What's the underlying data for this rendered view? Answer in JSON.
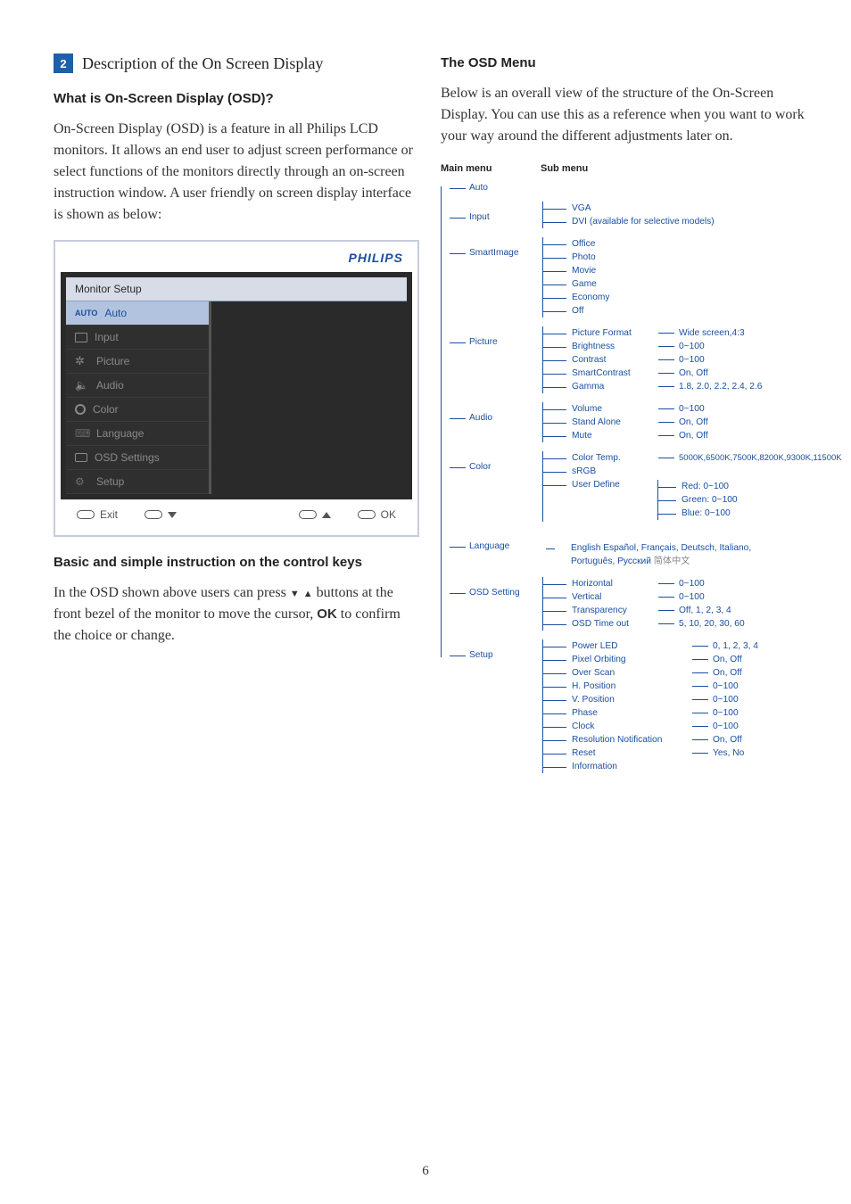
{
  "section": {
    "num": "2",
    "title": "Description of the On Screen Display"
  },
  "left": {
    "q": "What is On-Screen Display (OSD)?",
    "p1": "On-Screen Display (OSD) is a feature in all Philips LCD monitors. It allows an end user to adjust screen performance or select functions of the monitors directly through an on-screen instruction window. A user friendly on screen display interface is shown as below:",
    "basic_h": "Basic and simple instruction on the control keys",
    "p2a": "In the OSD shown above users can press ",
    "p2b": " buttons at the front bezel of the monitor to move the cursor, ",
    "p2c": " to confirm the choice or change.",
    "ok": "OK"
  },
  "osd": {
    "brand": "PHILIPS",
    "header": "Monitor Setup",
    "items": [
      {
        "badge": "AUTO",
        "label": "Auto",
        "sel": true
      },
      {
        "icon": "input-icon",
        "label": "Input"
      },
      {
        "icon": "picture-icon",
        "label": "Picture"
      },
      {
        "icon": "audio-icon",
        "label": "Audio"
      },
      {
        "icon": "color-icon",
        "label": "Color"
      },
      {
        "icon": "language-icon",
        "label": "Language"
      },
      {
        "icon": "osd-icon",
        "label": "OSD Settings"
      },
      {
        "icon": "setup-icon",
        "label": "Setup"
      }
    ],
    "footer": {
      "exit": "Exit",
      "ok": "OK"
    }
  },
  "right": {
    "h": "The OSD Menu",
    "p": "Below is an overall view of the structure of the On-Screen Display. You can use this as a reference when you want to work your way around the different adjustments later on.",
    "th_main": "Main menu",
    "th_sub": "Sub menu"
  },
  "tree": {
    "auto": "Auto",
    "input": {
      "label": "Input",
      "vga": "VGA",
      "dvi": "DVI (available for selective models)"
    },
    "smart": {
      "label": "SmartImage",
      "items": [
        "Office",
        "Photo",
        "Movie",
        "Game",
        "Economy",
        "Off"
      ]
    },
    "picture": {
      "label": "Picture",
      "rows": [
        {
          "k": "Picture Format",
          "v": "Wide screen,4:3"
        },
        {
          "k": "Brightness",
          "v": "0~100"
        },
        {
          "k": "Contrast",
          "v": "0~100"
        },
        {
          "k": "SmartContrast",
          "v": "On, Off"
        },
        {
          "k": "Gamma",
          "v": "1.8, 2.0, 2.2, 2.4, 2.6"
        }
      ]
    },
    "audio": {
      "label": "Audio",
      "rows": [
        {
          "k": "Volume",
          "v": "0~100"
        },
        {
          "k": "Stand Alone",
          "v": "On, Off"
        },
        {
          "k": "Mute",
          "v": "On, Off"
        }
      ]
    },
    "color": {
      "label": "Color",
      "temp_k": "Color Temp.",
      "temp_v": "5000K,6500K,7500K,8200K,9300K,11500K",
      "srgb": "sRGB",
      "ud": "User Define",
      "ud_items": [
        "Red: 0~100",
        "Green: 0~100",
        "Blue: 0~100"
      ]
    },
    "language": {
      "label": "Language",
      "line1a": "English",
      "line1b": "   Español, Français, Deutsch, Italiano,",
      "line2a": "Português, Русский   ",
      "line2b": "简体中文"
    },
    "osds": {
      "label": "OSD Setting",
      "rows": [
        {
          "k": "Horizontal",
          "v": "0~100"
        },
        {
          "k": "Vertical",
          "v": "0~100"
        },
        {
          "k": "Transparency",
          "v": "Off, 1, 2, 3, 4"
        },
        {
          "k": "OSD Time out",
          "v": "5, 10, 20, 30, 60"
        }
      ]
    },
    "setup": {
      "label": "Setup",
      "rows": [
        {
          "k": "Power LED",
          "v": "0, 1, 2, 3, 4",
          "wide": true
        },
        {
          "k": "Pixel Orbiting",
          "v": "On, Off",
          "wide": true
        },
        {
          "k": "Over Scan",
          "v": "On, Off",
          "wide": true
        },
        {
          "k": "H. Position",
          "v": "0~100",
          "wide": true
        },
        {
          "k": "V. Position",
          "v": "0~100",
          "wide": true
        },
        {
          "k": "Phase",
          "v": "0~100",
          "wide": true
        },
        {
          "k": "Clock",
          "v": "0~100",
          "wide": true
        },
        {
          "k": "Resolution Notification",
          "v": "On, Off",
          "wide": true
        },
        {
          "k": "Reset",
          "v": "Yes, No",
          "wide": true
        },
        {
          "k": "Information",
          "v": "",
          "wide": true,
          "noval": true
        }
      ]
    }
  },
  "page_num": "6"
}
